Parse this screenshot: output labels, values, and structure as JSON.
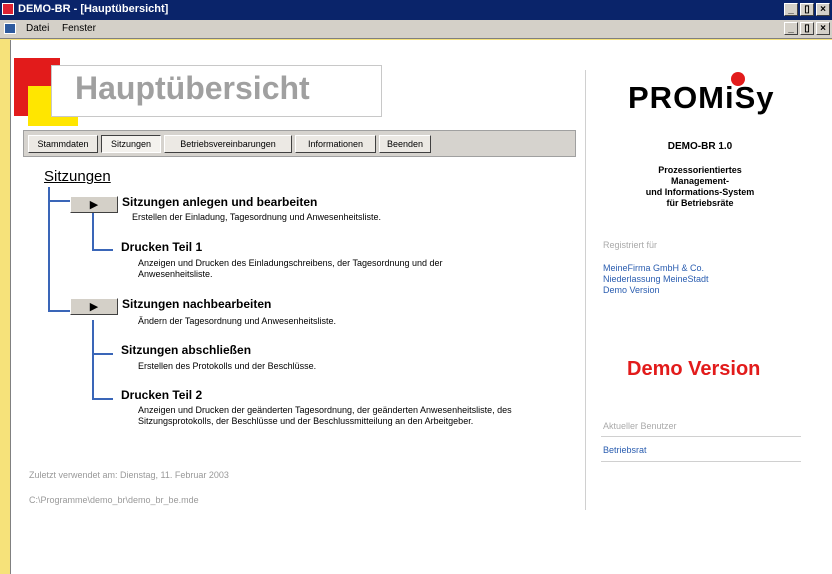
{
  "window": {
    "title": "DEMO-BR - [Hauptübersicht]",
    "buttons": [
      "_",
      "▯",
      "×"
    ]
  },
  "menubar": {
    "items": [
      "Datei",
      "Fenster"
    ],
    "mdi_buttons": [
      "_",
      "▯",
      "×"
    ]
  },
  "page": {
    "title": "Hauptübersicht"
  },
  "tabs": [
    {
      "label": "Stammdaten",
      "active": false
    },
    {
      "label": "Sitzungen",
      "active": true
    },
    {
      "label": "Betriebsvereinbarungen",
      "active": false
    },
    {
      "label": "Informationen",
      "active": false
    },
    {
      "label": "Beenden",
      "active": false
    }
  ],
  "main": {
    "section_title": "Sitzungen",
    "button_glyph": "▶",
    "entries": [
      {
        "title": "Sitzungen anlegen und bearbeiten",
        "desc": "Erstellen der Einladung, Tagesordnung und Anwesenheitsliste."
      },
      {
        "title": "Drucken Teil 1",
        "desc": "Anzeigen und Drucken des Einladungschreibens, der Tagesordnung und der Anwesenheitsliste."
      },
      {
        "title": "Sitzungen nachbearbeiten",
        "desc": "Ändern der Tagesordnung und Anwesenheitsliste."
      },
      {
        "title": "Sitzungen abschließen",
        "desc": "Erstellen des Protokolls und der Beschlüsse."
      },
      {
        "title": "Drucken Teil 2",
        "desc": "Anzeigen und Drucken der geänderten Tagesordnung, der geänderten Anwesenheitsliste, des Sitzungsprotokolls, der Beschlüsse und der Beschlussmitteilung an den Arbeitgeber."
      }
    ]
  },
  "footer": {
    "last_used": "Zuletzt verwendet am: Dienstag, 11. Februar 2003",
    "path": "C:\\Programme\\demo_br\\demo_br_be.mde"
  },
  "sidebar": {
    "logo_text": "PROMiSy",
    "product_name": "DEMO-BR 1.0",
    "description_lines": [
      "Prozessorientiertes",
      "Management-",
      "und Informations-System",
      "für Betriebsräte"
    ],
    "registered_label": "Registriert für",
    "registered_lines": [
      "MeineFirma GmbH & Co.",
      "Niederlassung MeineStadt",
      "Demo Version"
    ],
    "demo_banner": "Demo Version",
    "user_label": "Aktueller Benutzer",
    "user_name": "Betriebsrat"
  },
  "colors": {
    "titlebar": "#0a246a",
    "accent_red": "#e21b1b",
    "accent_yellow": "#ffe600",
    "link_blue": "#2a5db0",
    "tree_line": "#3a66b8"
  }
}
